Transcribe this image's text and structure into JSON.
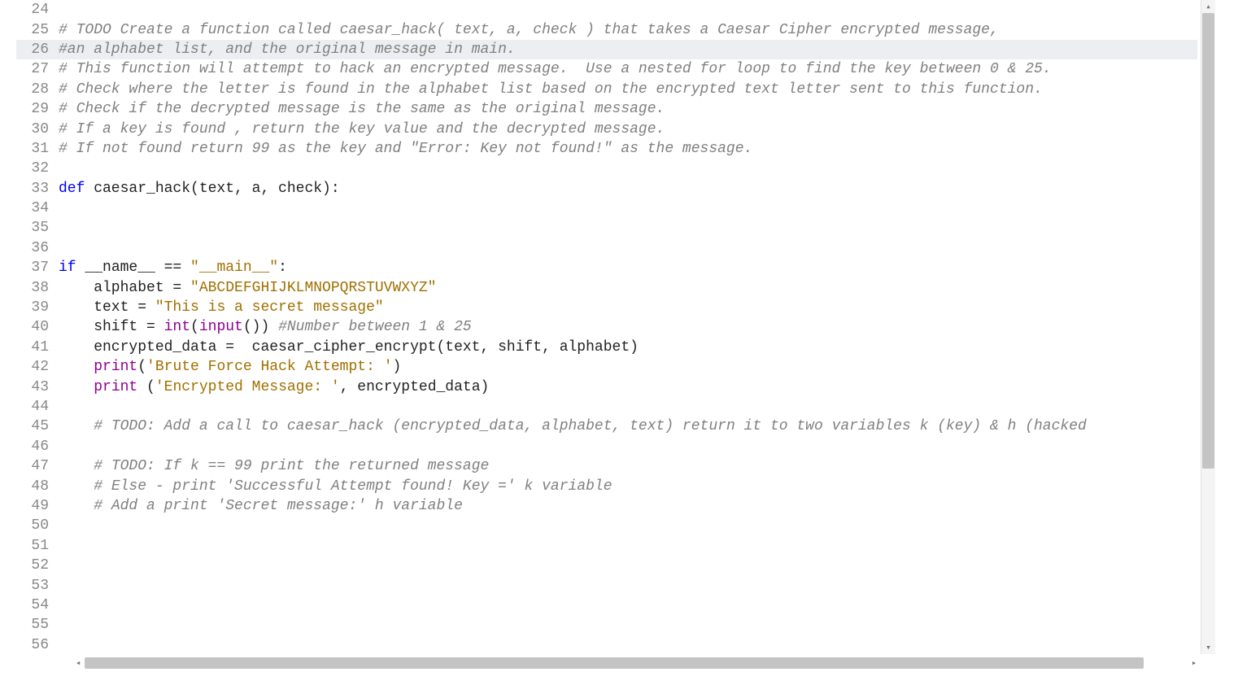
{
  "lines": [
    {
      "num": 24,
      "highlighted": false,
      "tokens": []
    },
    {
      "num": 25,
      "highlighted": false,
      "tokens": [
        {
          "cls": "tok-comment",
          "text": "# TODO Create a function called caesar_hack( text, a, check ) that takes a Caesar Cipher encrypted message,"
        }
      ]
    },
    {
      "num": 26,
      "highlighted": true,
      "tokens": [
        {
          "cls": "tok-comment",
          "text": "#an alphabet list, and the original message in main."
        }
      ]
    },
    {
      "num": 27,
      "highlighted": false,
      "tokens": [
        {
          "cls": "tok-comment",
          "text": "# This function will attempt to hack an encrypted message.  Use a nested for loop to find the key between 0 & 25."
        }
      ]
    },
    {
      "num": 28,
      "highlighted": false,
      "tokens": [
        {
          "cls": "tok-comment",
          "text": "# Check where the letter is found in the alphabet list based on the encrypted text letter sent to this function."
        }
      ]
    },
    {
      "num": 29,
      "highlighted": false,
      "tokens": [
        {
          "cls": "tok-comment",
          "text": "# Check if the decrypted message is the same as the original message."
        }
      ]
    },
    {
      "num": 30,
      "highlighted": false,
      "tokens": [
        {
          "cls": "tok-comment",
          "text": "# If a key is found , return the key value and the decrypted message."
        }
      ]
    },
    {
      "num": 31,
      "highlighted": false,
      "tokens": [
        {
          "cls": "tok-comment",
          "text": "# If not found return 99 as the key and \"Error: Key not found!\" as the message."
        }
      ]
    },
    {
      "num": 32,
      "highlighted": false,
      "tokens": []
    },
    {
      "num": 33,
      "highlighted": false,
      "tokens": [
        {
          "cls": "tok-keyword",
          "text": "def"
        },
        {
          "cls": "tok-ident",
          "text": " caesar_hack(text, a, check):"
        }
      ]
    },
    {
      "num": 34,
      "highlighted": false,
      "tokens": []
    },
    {
      "num": 35,
      "highlighted": false,
      "tokens": []
    },
    {
      "num": 36,
      "highlighted": false,
      "tokens": []
    },
    {
      "num": 37,
      "highlighted": false,
      "tokens": [
        {
          "cls": "tok-keyword",
          "text": "if"
        },
        {
          "cls": "tok-ident",
          "text": " __name__ == "
        },
        {
          "cls": "tok-string",
          "text": "\"__main__\""
        },
        {
          "cls": "tok-ident",
          "text": ":"
        }
      ]
    },
    {
      "num": 38,
      "highlighted": false,
      "tokens": [
        {
          "cls": "tok-ident",
          "text": "    alphabet = "
        },
        {
          "cls": "tok-string",
          "text": "\"ABCDEFGHIJKLMNOPQRSTUVWXYZ\""
        }
      ]
    },
    {
      "num": 39,
      "highlighted": false,
      "tokens": [
        {
          "cls": "tok-ident",
          "text": "    text = "
        },
        {
          "cls": "tok-string",
          "text": "\"This is a secret message\""
        }
      ]
    },
    {
      "num": 40,
      "highlighted": false,
      "tokens": [
        {
          "cls": "tok-ident",
          "text": "    shift = "
        },
        {
          "cls": "tok-builtin",
          "text": "int"
        },
        {
          "cls": "tok-ident",
          "text": "("
        },
        {
          "cls": "tok-builtin",
          "text": "input"
        },
        {
          "cls": "tok-ident",
          "text": "()) "
        },
        {
          "cls": "tok-comment",
          "text": "#Number between 1 & 25"
        }
      ]
    },
    {
      "num": 41,
      "highlighted": false,
      "tokens": [
        {
          "cls": "tok-ident",
          "text": "    encrypted_data =  caesar_cipher_encrypt(text, shift, alphabet)"
        }
      ]
    },
    {
      "num": 42,
      "highlighted": false,
      "tokens": [
        {
          "cls": "tok-ident",
          "text": "    "
        },
        {
          "cls": "tok-builtin",
          "text": "print"
        },
        {
          "cls": "tok-ident",
          "text": "("
        },
        {
          "cls": "tok-string",
          "text": "'Brute Force Hack Attempt: '"
        },
        {
          "cls": "tok-ident",
          "text": ")"
        }
      ]
    },
    {
      "num": 43,
      "highlighted": false,
      "tokens": [
        {
          "cls": "tok-ident",
          "text": "    "
        },
        {
          "cls": "tok-builtin",
          "text": "print"
        },
        {
          "cls": "tok-ident",
          "text": " ("
        },
        {
          "cls": "tok-string",
          "text": "'Encrypted Message: '"
        },
        {
          "cls": "tok-ident",
          "text": ", encrypted_data)"
        }
      ]
    },
    {
      "num": 44,
      "highlighted": false,
      "tokens": []
    },
    {
      "num": 45,
      "highlighted": false,
      "tokens": [
        {
          "cls": "tok-ident",
          "text": "    "
        },
        {
          "cls": "tok-comment",
          "text": "# TODO: Add a call to caesar_hack (encrypted_data, alphabet, text) return it to two variables k (key) & h (hacked"
        }
      ]
    },
    {
      "num": 46,
      "highlighted": false,
      "tokens": []
    },
    {
      "num": 47,
      "highlighted": false,
      "tokens": [
        {
          "cls": "tok-ident",
          "text": "    "
        },
        {
          "cls": "tok-comment",
          "text": "# TODO: If k == 99 print the returned message"
        }
      ]
    },
    {
      "num": 48,
      "highlighted": false,
      "tokens": [
        {
          "cls": "tok-ident",
          "text": "    "
        },
        {
          "cls": "tok-comment",
          "text": "# Else - print 'Successful Attempt found! Key =' k variable"
        }
      ]
    },
    {
      "num": 49,
      "highlighted": false,
      "tokens": [
        {
          "cls": "tok-ident",
          "text": "    "
        },
        {
          "cls": "tok-comment",
          "text": "# Add a print 'Secret message:' h variable"
        }
      ]
    },
    {
      "num": 50,
      "highlighted": false,
      "tokens": []
    },
    {
      "num": 51,
      "highlighted": false,
      "tokens": []
    },
    {
      "num": 52,
      "highlighted": false,
      "tokens": []
    },
    {
      "num": 53,
      "highlighted": false,
      "tokens": []
    },
    {
      "num": 54,
      "highlighted": false,
      "tokens": []
    },
    {
      "num": 55,
      "highlighted": false,
      "tokens": []
    },
    {
      "num": 56,
      "highlighted": false,
      "tokens": []
    }
  ],
  "scroll": {
    "v_up": "▴",
    "v_down": "▾",
    "h_left": "◂",
    "h_right": "▸"
  }
}
